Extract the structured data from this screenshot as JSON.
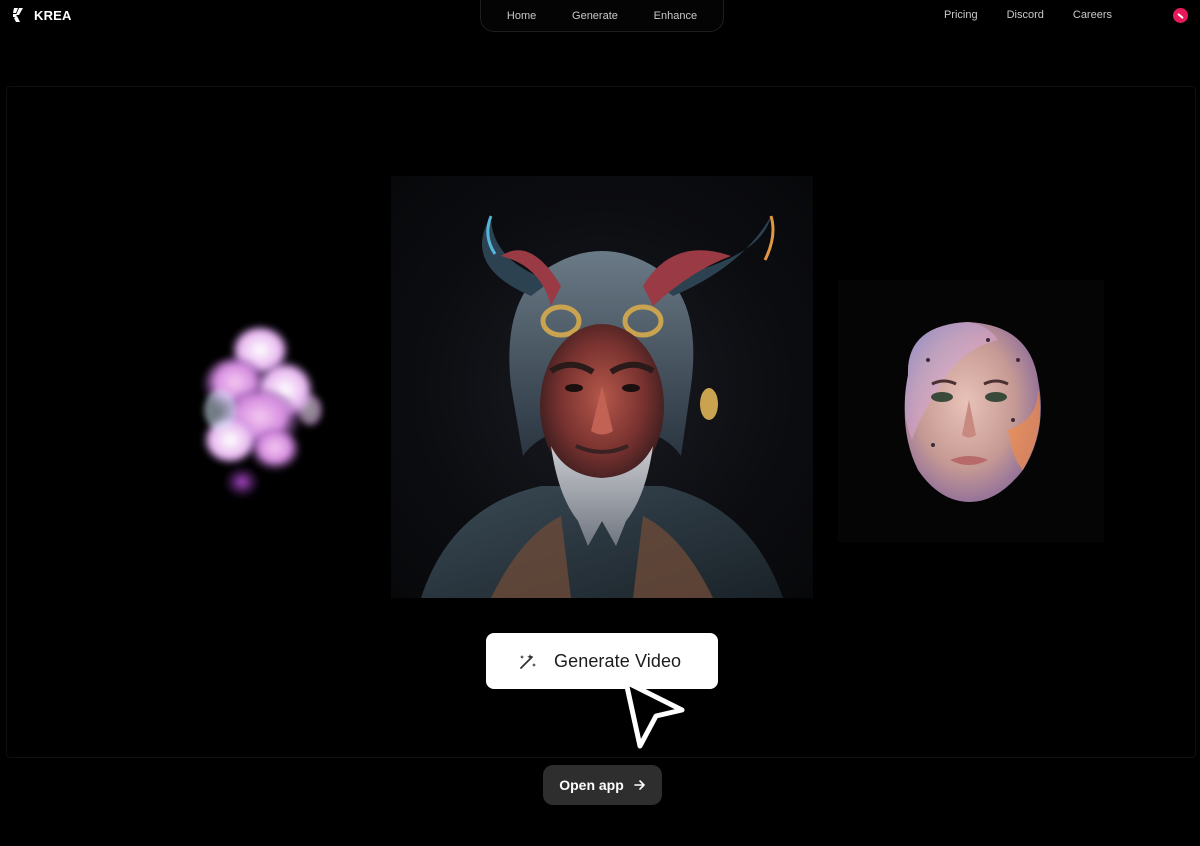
{
  "brand": {
    "name": "KREA"
  },
  "center_nav": [
    {
      "label": "Home"
    },
    {
      "label": "Generate"
    },
    {
      "label": "Enhance"
    }
  ],
  "right_nav": [
    {
      "label": "Pricing"
    },
    {
      "label": "Discord"
    },
    {
      "label": "Careers"
    }
  ],
  "hero": {
    "images": [
      "smoke-image",
      "horned-warrior-portrait",
      "painted-face-image"
    ],
    "generate_button": {
      "label": "Generate Video",
      "icon": "magic-wand-icon"
    },
    "cursor_icon": "pointer-cursor-icon"
  },
  "cta": {
    "label": "Open app",
    "icon": "arrow-right-icon"
  },
  "colors": {
    "background": "#000000",
    "avatar": "#e8195b",
    "cta_bg": "#2e2e2e",
    "generate_bg": "#ffffff"
  }
}
